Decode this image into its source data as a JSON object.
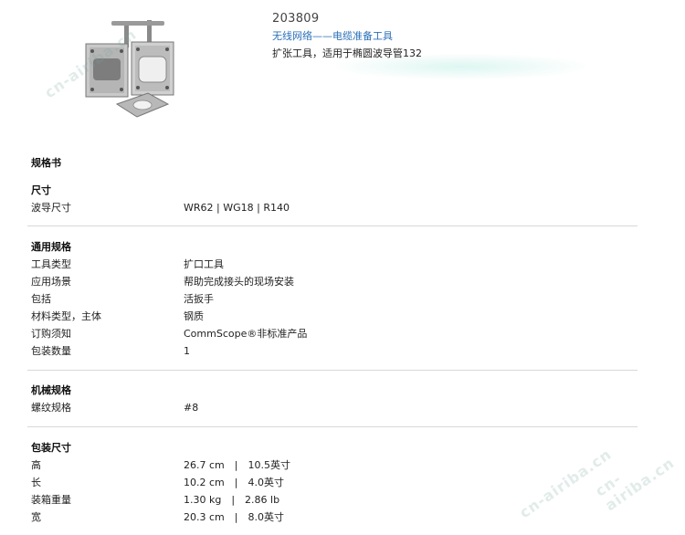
{
  "header": {
    "part_number": "203809",
    "category": "无线网络——电缆准备工具",
    "description": "扩张工具，适用于椭圆波导管132"
  },
  "spec_title": "规格书",
  "sections": {
    "size": {
      "heading": "尺寸",
      "rows": [
        {
          "label": "波导尺寸",
          "value": "WR62 | WG18 | R140"
        }
      ]
    },
    "general": {
      "heading": "通用规格",
      "rows": [
        {
          "label": "工具类型",
          "value": "扩口工具"
        },
        {
          "label": "应用场景",
          "value": "帮助完成接头的现场安装"
        },
        {
          "label": "包括",
          "value": "活扳手"
        },
        {
          "label": "材料类型，主体",
          "value": "钢质"
        },
        {
          "label": "订购须知",
          "value": "CommScope®非标准产品"
        },
        {
          "label": "包装数量",
          "value": "1"
        }
      ]
    },
    "mechanical": {
      "heading": "机械规格",
      "rows": [
        {
          "label": "螺纹规格",
          "value": "#8"
        }
      ]
    },
    "package": {
      "heading": "包装尺寸",
      "rows": [
        {
          "label": "高",
          "value": "26.7 cm　|　10.5英寸"
        },
        {
          "label": "长",
          "value": "10.2 cm　|　4.0英寸"
        },
        {
          "label": "装箱重量",
          "value": "1.30 kg　|　2.86 lb"
        },
        {
          "label": "宽",
          "value": "20.3 cm　|　8.0英寸"
        }
      ]
    }
  },
  "watermarks": [
    "cn-airiba.cn",
    "cn-airiba.cn",
    "cn-airiba.cn"
  ],
  "colors": {
    "link": "#2a6fb8",
    "divider": "#d8d8d8"
  }
}
